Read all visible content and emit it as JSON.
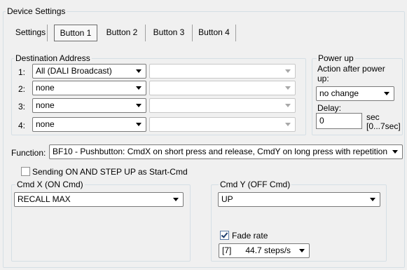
{
  "window": {
    "title": "Device Settings"
  },
  "tabs": [
    {
      "label": "Settings",
      "active": false
    },
    {
      "label": "Button 1",
      "active": true
    },
    {
      "label": "Button 2",
      "active": false
    },
    {
      "label": "Button 3",
      "active": false
    },
    {
      "label": "Button 4",
      "active": false
    }
  ],
  "destination": {
    "title": "Destination Address",
    "rows": [
      {
        "index": "1:",
        "value": "All (DALI Broadcast)",
        "secondary": ""
      },
      {
        "index": "2:",
        "value": "none",
        "secondary": ""
      },
      {
        "index": "3:",
        "value": "none",
        "secondary": ""
      },
      {
        "index": "4:",
        "value": "none",
        "secondary": ""
      }
    ]
  },
  "powerup": {
    "title": "Power up",
    "action_label": "Action after power up:",
    "action_value": "no change",
    "delay_label": "Delay:",
    "delay_value": "0",
    "delay_unit": "sec",
    "delay_range": "[0...7sec]"
  },
  "function": {
    "label": "Function:",
    "value": "BF10 - Pushbutton:  CmdX on short press and release, CmdY on long press with repetition"
  },
  "start_cmd": {
    "label": "Sending ON AND STEP UP as Start-Cmd",
    "checked": false
  },
  "cmd_x": {
    "title": "Cmd X  (ON Cmd)",
    "value": "RECALL MAX"
  },
  "cmd_y": {
    "title": "Cmd Y  (OFF Cmd)",
    "value": "UP",
    "fade_label": "Fade rate",
    "fade_checked": true,
    "fade_value": "[7]      44.7 steps/s"
  },
  "colors": {
    "border": "#d5dfe5",
    "background": "#f0f0f0"
  }
}
